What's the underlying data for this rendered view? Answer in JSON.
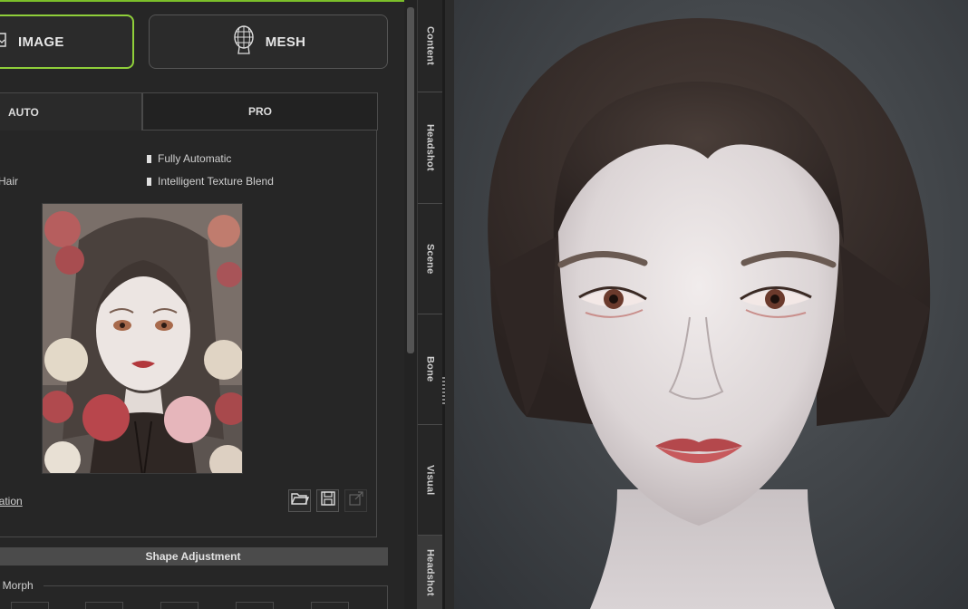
{
  "modes": {
    "image_label": "IMAGE",
    "mesh_label": "MESH"
  },
  "tabs": {
    "auto": "AUTO",
    "pro": "PRO"
  },
  "features": {
    "left_partial": "Hair",
    "fully_automatic": "Fully Automatic",
    "texture_blend": "Intelligent Texture Blend"
  },
  "link_partial": "aration",
  "section": {
    "shape_adjustment": "Shape Adjustment",
    "morph_label": "t Morph"
  },
  "side_tabs": [
    "Content",
    "Headshot",
    "Scene",
    "Bone",
    "Visual",
    "Headshot"
  ],
  "icons": {
    "open": "folder-open-icon",
    "save": "save-icon",
    "export": "export-icon",
    "mesh": "head-mesh-icon",
    "image": "image-icon"
  },
  "colors": {
    "accent": "#8fcf3a",
    "panel": "#262626"
  }
}
